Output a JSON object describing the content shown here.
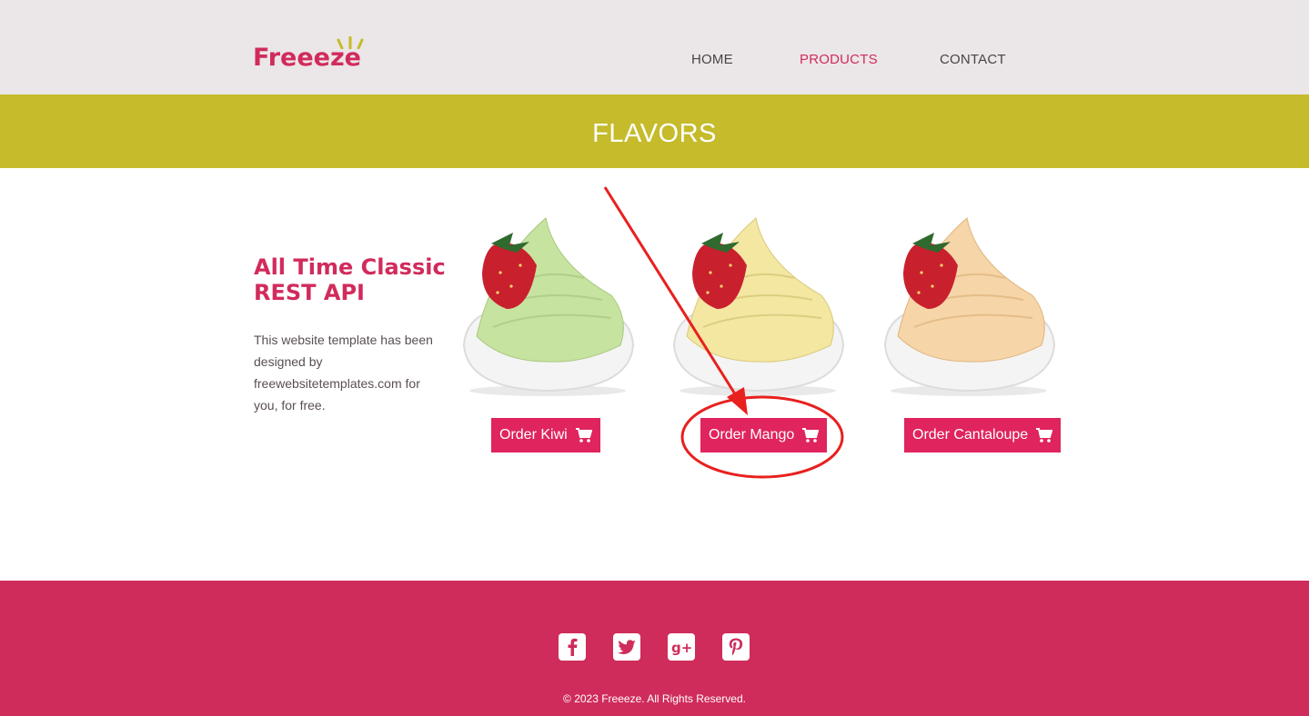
{
  "header": {
    "logo_text": "Freeeze",
    "nav": [
      {
        "label": "HOME",
        "active": false
      },
      {
        "label": "PRODUCTS",
        "active": true
      },
      {
        "label": "CONTACT",
        "active": false
      }
    ]
  },
  "banner": {
    "title": "FLAVORS"
  },
  "intro": {
    "title_line1": "All Time Classic",
    "title_line2": "REST API",
    "body": "This website template has been designed by freewebsitetemplates.com for you, for free."
  },
  "products": [
    {
      "flavor": "kiwi",
      "button_label": "Order Kiwi",
      "cream_color": "#c7e3a0"
    },
    {
      "flavor": "mango",
      "button_label": "Order Mango",
      "cream_color": "#f3e7a2"
    },
    {
      "flavor": "cantaloupe",
      "button_label": "Order Cantaloupe",
      "cream_color": "#f6d5a8"
    }
  ],
  "footer": {
    "social": [
      {
        "name": "facebook-icon",
        "glyph": "f"
      },
      {
        "name": "twitter-icon",
        "glyph": "t"
      },
      {
        "name": "google-plus-icon",
        "glyph": "g+"
      },
      {
        "name": "pinterest-icon",
        "glyph": "p"
      }
    ],
    "copyright": "© 2023 Freeeze. All Rights Reserved."
  },
  "colors": {
    "brand": "#d12b5c",
    "banner": "#c5bb2b",
    "button": "#e0245e",
    "footer": "#cf2c5b",
    "annotation": "#e8201e"
  }
}
